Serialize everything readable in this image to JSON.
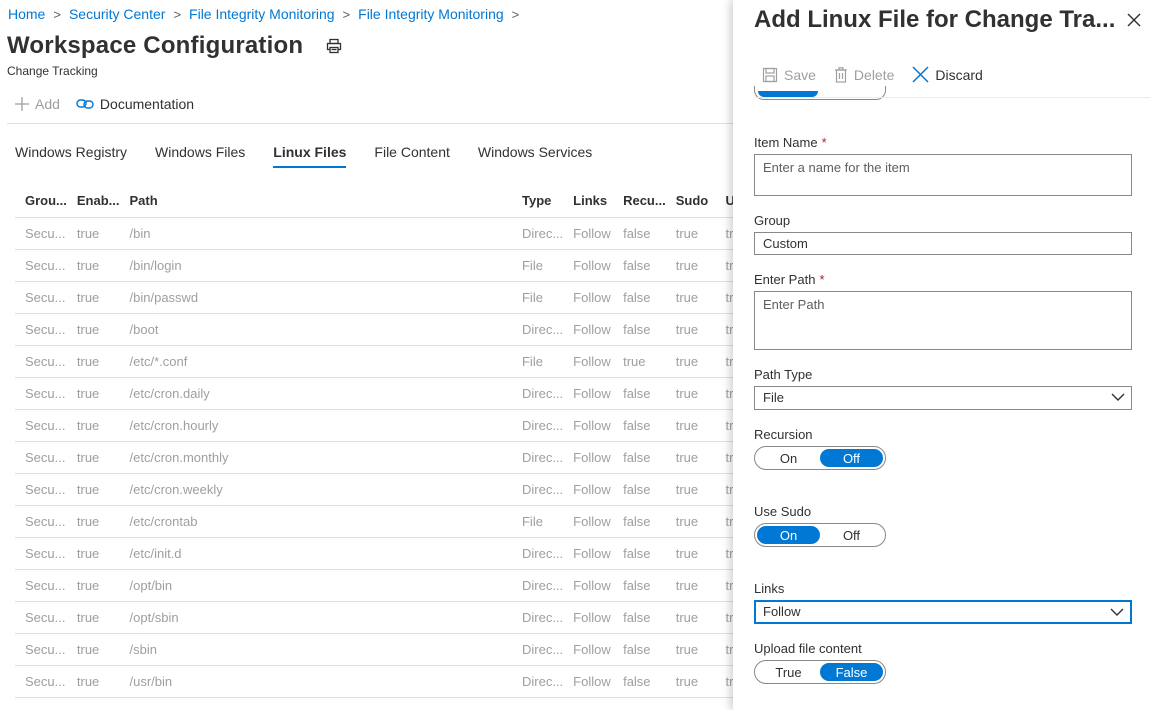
{
  "breadcrumb": {
    "items": [
      "Home",
      "Security Center",
      "File Integrity Monitoring",
      "File Integrity Monitoring"
    ],
    "separator": ">"
  },
  "page": {
    "title": "Workspace Configuration",
    "subtitle": "Change Tracking"
  },
  "toolbar": {
    "add_label": "Add",
    "documentation_label": "Documentation"
  },
  "tabs": [
    {
      "label": "Windows Registry",
      "active": false
    },
    {
      "label": "Windows Files",
      "active": false
    },
    {
      "label": "Linux Files",
      "active": true
    },
    {
      "label": "File Content",
      "active": false
    },
    {
      "label": "Windows Services",
      "active": false
    }
  ],
  "table": {
    "columns": [
      "Grou...",
      "Enab...",
      "Path",
      "Type",
      "Links",
      "Recu...",
      "Sudo",
      "U"
    ],
    "rows": [
      [
        "Secu...",
        "true",
        "/bin",
        "Direc...",
        "Follow",
        "false",
        "true",
        "tr"
      ],
      [
        "Secu...",
        "true",
        "/bin/login",
        "File",
        "Follow",
        "false",
        "true",
        "tr"
      ],
      [
        "Secu...",
        "true",
        "/bin/passwd",
        "File",
        "Follow",
        "false",
        "true",
        "tr"
      ],
      [
        "Secu...",
        "true",
        "/boot",
        "Direc...",
        "Follow",
        "false",
        "true",
        "tr"
      ],
      [
        "Secu...",
        "true",
        "/etc/*.conf",
        "File",
        "Follow",
        "true",
        "true",
        "tr"
      ],
      [
        "Secu...",
        "true",
        "/etc/cron.daily",
        "Direc...",
        "Follow",
        "false",
        "true",
        "tr"
      ],
      [
        "Secu...",
        "true",
        "/etc/cron.hourly",
        "Direc...",
        "Follow",
        "false",
        "true",
        "tr"
      ],
      [
        "Secu...",
        "true",
        "/etc/cron.monthly",
        "Direc...",
        "Follow",
        "false",
        "true",
        "tr"
      ],
      [
        "Secu...",
        "true",
        "/etc/cron.weekly",
        "Direc...",
        "Follow",
        "false",
        "true",
        "tr"
      ],
      [
        "Secu...",
        "true",
        "/etc/crontab",
        "File",
        "Follow",
        "false",
        "true",
        "tr"
      ],
      [
        "Secu...",
        "true",
        "/etc/init.d",
        "Direc...",
        "Follow",
        "false",
        "true",
        "tr"
      ],
      [
        "Secu...",
        "true",
        "/opt/bin",
        "Direc...",
        "Follow",
        "false",
        "true",
        "tr"
      ],
      [
        "Secu...",
        "true",
        "/opt/sbin",
        "Direc...",
        "Follow",
        "false",
        "true",
        "tr"
      ],
      [
        "Secu...",
        "true",
        "/sbin",
        "Direc...",
        "Follow",
        "false",
        "true",
        "tr"
      ],
      [
        "Secu...",
        "true",
        "/usr/bin",
        "Direc...",
        "Follow",
        "false",
        "true",
        "tr"
      ]
    ]
  },
  "panel": {
    "title": "Add Linux File for Change Tra...",
    "save_label": "Save",
    "delete_label": "Delete",
    "discard_label": "Discard",
    "item_name": {
      "label": "Item Name",
      "required_mark": "*",
      "placeholder": "Enter a name for the item",
      "value": ""
    },
    "group": {
      "label": "Group",
      "value": "Custom"
    },
    "path": {
      "label": "Enter Path",
      "required_mark": "*",
      "placeholder": "Enter Path",
      "value": ""
    },
    "path_type": {
      "label": "Path Type",
      "value": "File"
    },
    "recursion": {
      "label": "Recursion",
      "on_label": "On",
      "off_label": "Off",
      "selected": "Off"
    },
    "use_sudo": {
      "label": "Use Sudo",
      "on_label": "On",
      "off_label": "Off",
      "selected": "On"
    },
    "links": {
      "label": "Links",
      "value": "Follow"
    },
    "upload_file_content": {
      "label": "Upload file content",
      "true_label": "True",
      "false_label": "False",
      "selected": "False"
    }
  },
  "colors": {
    "accent": "#0078d4",
    "link": "#0078d4",
    "required": "#a4262c",
    "muted_text": "#a19f9d"
  },
  "icons": {
    "print": "printer-icon",
    "add": "plus-icon",
    "documentation": "link-icon",
    "save": "save-icon",
    "delete": "trash-icon",
    "discard": "x-icon",
    "close": "close-icon",
    "dropdown": "chevron-down-icon"
  }
}
